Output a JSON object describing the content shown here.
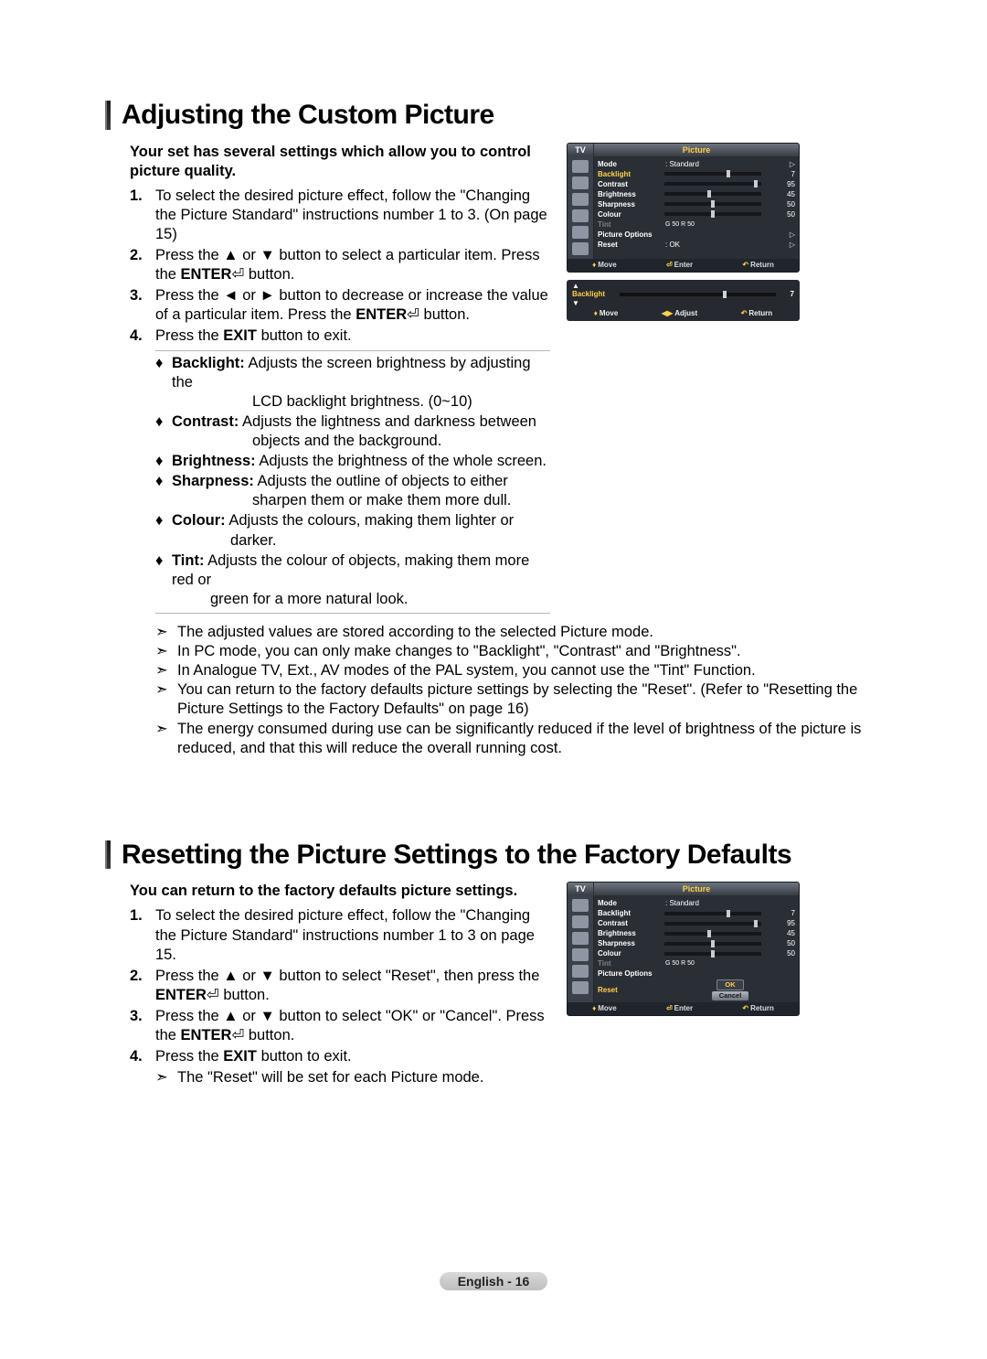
{
  "section1": {
    "heading": "Adjusting the Custom Picture",
    "intro": "Your set has several settings which allow you to control picture quality.",
    "steps": [
      {
        "n": "1.",
        "text": "To select the desired picture effect, follow the \"Changing the Picture Standard\" instructions number 1 to 3. (On page 15)"
      },
      {
        "n": "2.",
        "pre": "Press the ▲ or ▼ button to select a particular item. Press the ",
        "bold": "ENTER",
        "glyph": "⏎",
        "post": " button."
      },
      {
        "n": "3.",
        "pre": "Press the ◄ or ► button to decrease or increase the value of a particular item. Press the ",
        "bold": "ENTER",
        "glyph": "⏎",
        "post": " button."
      },
      {
        "n": "4.",
        "pre": "Press the ",
        "bold": "EXIT",
        "post": " button to exit."
      }
    ],
    "bullets": [
      {
        "b": "Backlight:",
        "t": " Adjusts the screen brightness by adjusting the",
        "t2": "LCD backlight brightness. (0~10)"
      },
      {
        "b": "Contrast:",
        "t": " Adjusts the lightness and darkness between",
        "t2": "objects and the background."
      },
      {
        "b": "Brightness:",
        "t": " Adjusts the brightness of the whole screen."
      },
      {
        "b": "Sharpness:",
        "t": " Adjusts the outline of objects to either",
        "t2": "sharpen them or make them more dull."
      },
      {
        "b": "Colour:",
        "t": " Adjusts the colours, making them lighter or",
        "t2": "darker."
      },
      {
        "b": "Tint:",
        "t": " Adjusts the colour of objects, making them more red or",
        "t2": "green for a more natural look."
      }
    ],
    "notes": [
      "The adjusted values are stored according to the selected Picture mode.",
      "In PC mode, you can only make changes to \"Backlight\", \"Contrast\" and \"Brightness\".",
      "In Analogue TV, Ext., AV modes of the PAL system, you cannot use the \"Tint\" Function.",
      "You can return to the factory defaults picture settings by selecting the \"Reset\". (Refer to \"Resetting the Picture Settings to the Factory Defaults\" on page 16)",
      "The energy consumed during use can be significantly reduced if the level of brightness of the picture is reduced, and that this will reduce the overall running cost."
    ]
  },
  "section2": {
    "heading": "Resetting the Picture Settings to the Factory Defaults",
    "intro": "You can return to the factory defaults picture settings.",
    "steps": [
      {
        "n": "1.",
        "text": "To select the desired picture effect, follow the \"Changing the Picture Standard\" instructions number 1 to 3 on page 15."
      },
      {
        "n": "2.",
        "pre": "Press the ▲ or ▼ button to select \"Reset\", then press the ",
        "bold": "ENTER",
        "glyph": "⏎",
        "post": " button."
      },
      {
        "n": "3.",
        "pre": "Press the ▲ or ▼ button to select \"OK\" or \"Cancel\". Press the ",
        "bold": "ENTER",
        "glyph": "⏎",
        "post": " button."
      },
      {
        "n": "4.",
        "pre": "Press the ",
        "bold": "EXIT",
        "post": " button to exit."
      }
    ],
    "note": "The \"Reset\" will be set for each Picture mode."
  },
  "osd": {
    "tv": "TV",
    "title": "Picture",
    "rows": {
      "mode_l": "Mode",
      "mode_v": ": Standard",
      "backlight_l": "Backlight",
      "backlight_v": "7",
      "contrast_l": "Contrast",
      "contrast_v": "95",
      "brightness_l": "Brightness",
      "brightness_v": "45",
      "sharpness_l": "Sharpness",
      "sharpness_v": "50",
      "colour_l": "Colour",
      "colour_v": "50",
      "tint_l": "Tint",
      "tint_v": "G 50                R 50",
      "picopt_l": "Picture Options",
      "reset_l": "Reset",
      "reset_v": ": OK"
    },
    "ftr": {
      "move": "Move",
      "enter": "Enter",
      "return": "Return",
      "adjust": "Adjust"
    },
    "slim": {
      "label": "Backlight",
      "value": "7"
    },
    "reset_ok": "OK",
    "reset_cancel": "Cancel"
  },
  "footer": "English - 16",
  "glyphs": {
    "diamond": "♦",
    "updown": "◆",
    "lr": "◀▶",
    "ret": "↶",
    "enter": "⏎"
  }
}
